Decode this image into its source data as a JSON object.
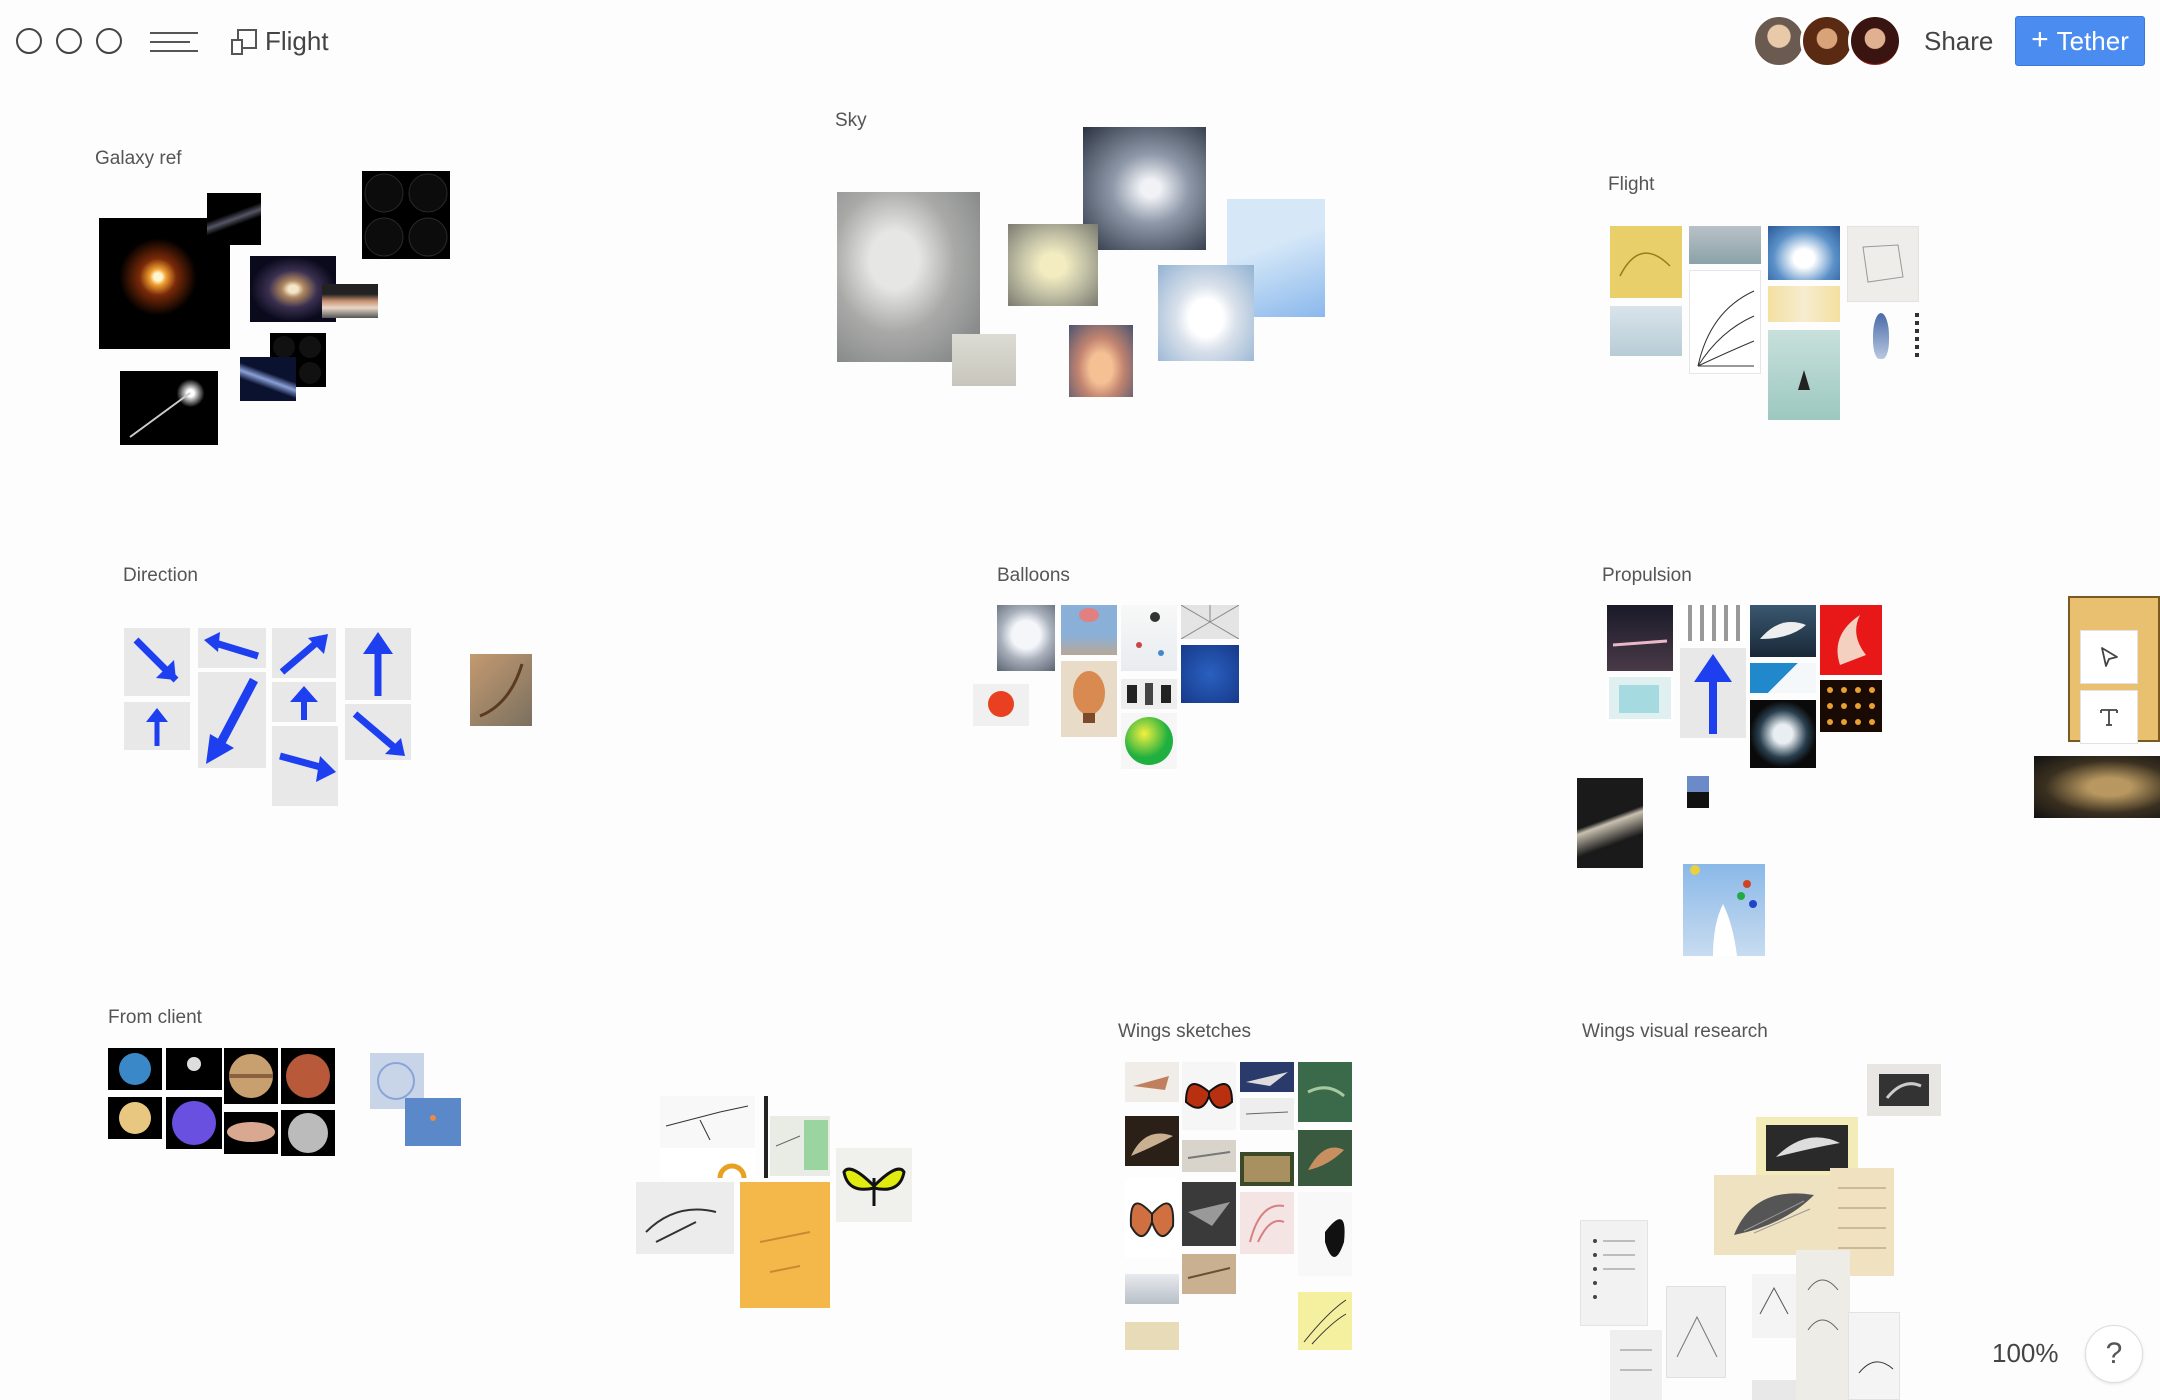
{
  "app": {
    "board_title": "Flight",
    "share_label": "Share",
    "tether_label": "Tether",
    "zoom_level": "100%",
    "help_label": "?"
  },
  "colors": {
    "accent": "#4b8cf0",
    "arrow_blue": "#1d3ff0"
  },
  "icons": {
    "window_controls": [
      "window-circle-icon",
      "window-circle-icon",
      "window-circle-icon"
    ],
    "menu": "hamburger-icon",
    "board": "board-icon",
    "tether": "plus-icon",
    "tools": [
      "pointer-icon",
      "text-tool-icon"
    ],
    "help": "help-icon"
  },
  "avatars": [
    "collaborator-1",
    "collaborator-2",
    "collaborator-3"
  ],
  "clusters": [
    {
      "id": "galaxy",
      "label": "Galaxy ref"
    },
    {
      "id": "sky",
      "label": "Sky"
    },
    {
      "id": "flight",
      "label": "Flight"
    },
    {
      "id": "direction",
      "label": "Direction"
    },
    {
      "id": "balloons",
      "label": "Balloons"
    },
    {
      "id": "propulsion",
      "label": "Propulsion"
    },
    {
      "id": "client",
      "label": "From client"
    },
    {
      "id": "unlabeled",
      "label": ""
    },
    {
      "id": "wings_sketches",
      "label": "Wings sketches"
    },
    {
      "id": "wings_visual",
      "label": "Wings visual research"
    }
  ]
}
